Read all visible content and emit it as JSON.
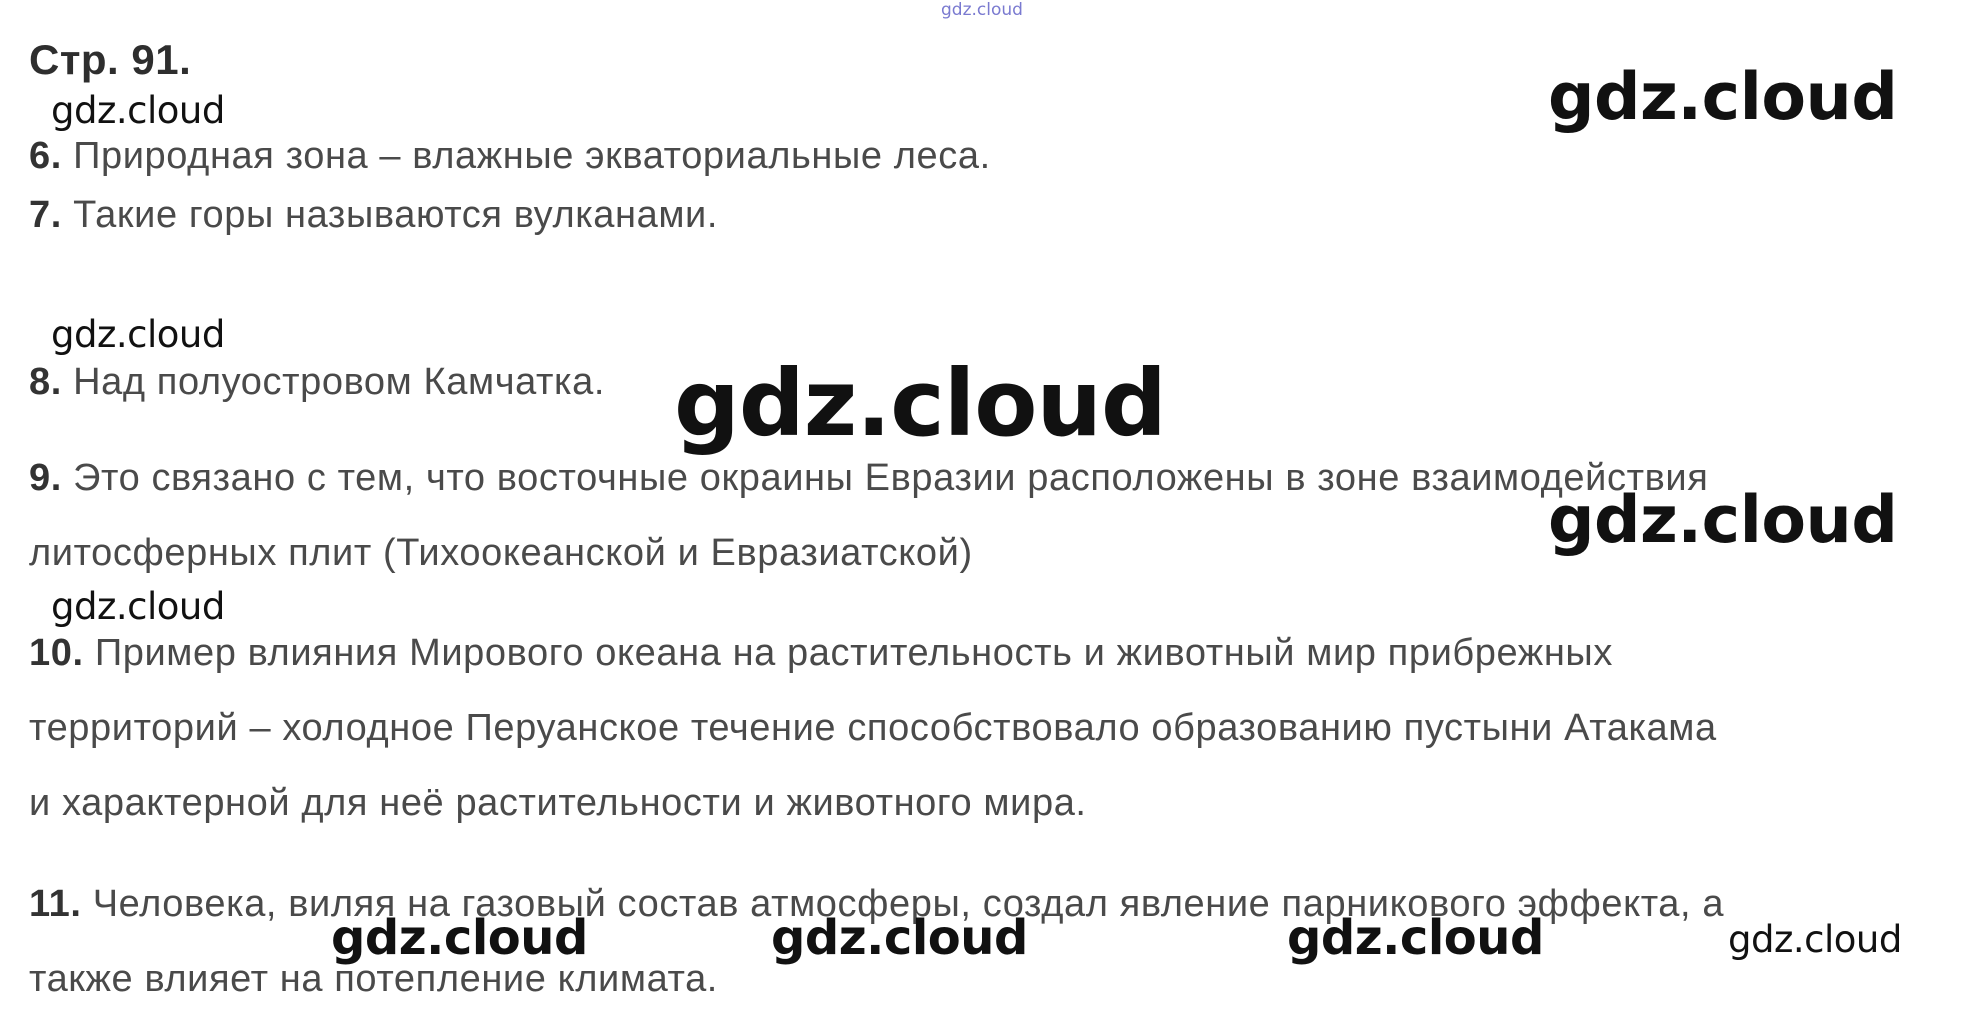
{
  "header": {
    "page_label": "Стр. 91."
  },
  "answers": [
    {
      "num": "6.",
      "lines": [
        "Природная зона – влажные экваториальные леса."
      ]
    },
    {
      "num": "7.",
      "lines": [
        "Такие горы называются вулканами."
      ]
    },
    {
      "num": "8.",
      "lines": [
        "Над полуостровом Камчатка."
      ]
    },
    {
      "num": "9.",
      "lines": [
        "Это связано с тем, что восточные окраины Евразии расположены в зоне взаимодействия",
        "литосферных плит (Тихоокеанской и Евразиатской)"
      ]
    },
    {
      "num": "10.",
      "lines": [
        "Пример влияния Мирового океана на растительность и животный мир прибрежных",
        "территорий –  холодное Перуанское течение способствовало образованию пустыни Атакама",
        "и характерной для неё растительности и животного мира."
      ]
    },
    {
      "num": "11.",
      "lines": [
        "Человека, виляя на газовый состав атмосферы, создал явление парникового эффекта, а",
        "также влияет на потепление климата."
      ]
    }
  ],
  "watermarks": {
    "top_center": "gdz.cloud",
    "left_1": "gdz.cloud",
    "left_2": "gdz.cloud",
    "left_3": "gdz.cloud",
    "right_top": "gdz.cloud",
    "right_middle": "gdz.cloud",
    "center_large": "gdz.cloud",
    "bottom_1": "gdz.cloud",
    "bottom_2": "gdz.cloud",
    "bottom_3": "gdz.cloud",
    "bottom_4": "gdz.cloud"
  },
  "colors": {
    "text": "#4a4a4a",
    "number": "#333333",
    "watermark": "#111111",
    "watermark_tiny": "#7a7ad0",
    "background": "#ffffff"
  }
}
